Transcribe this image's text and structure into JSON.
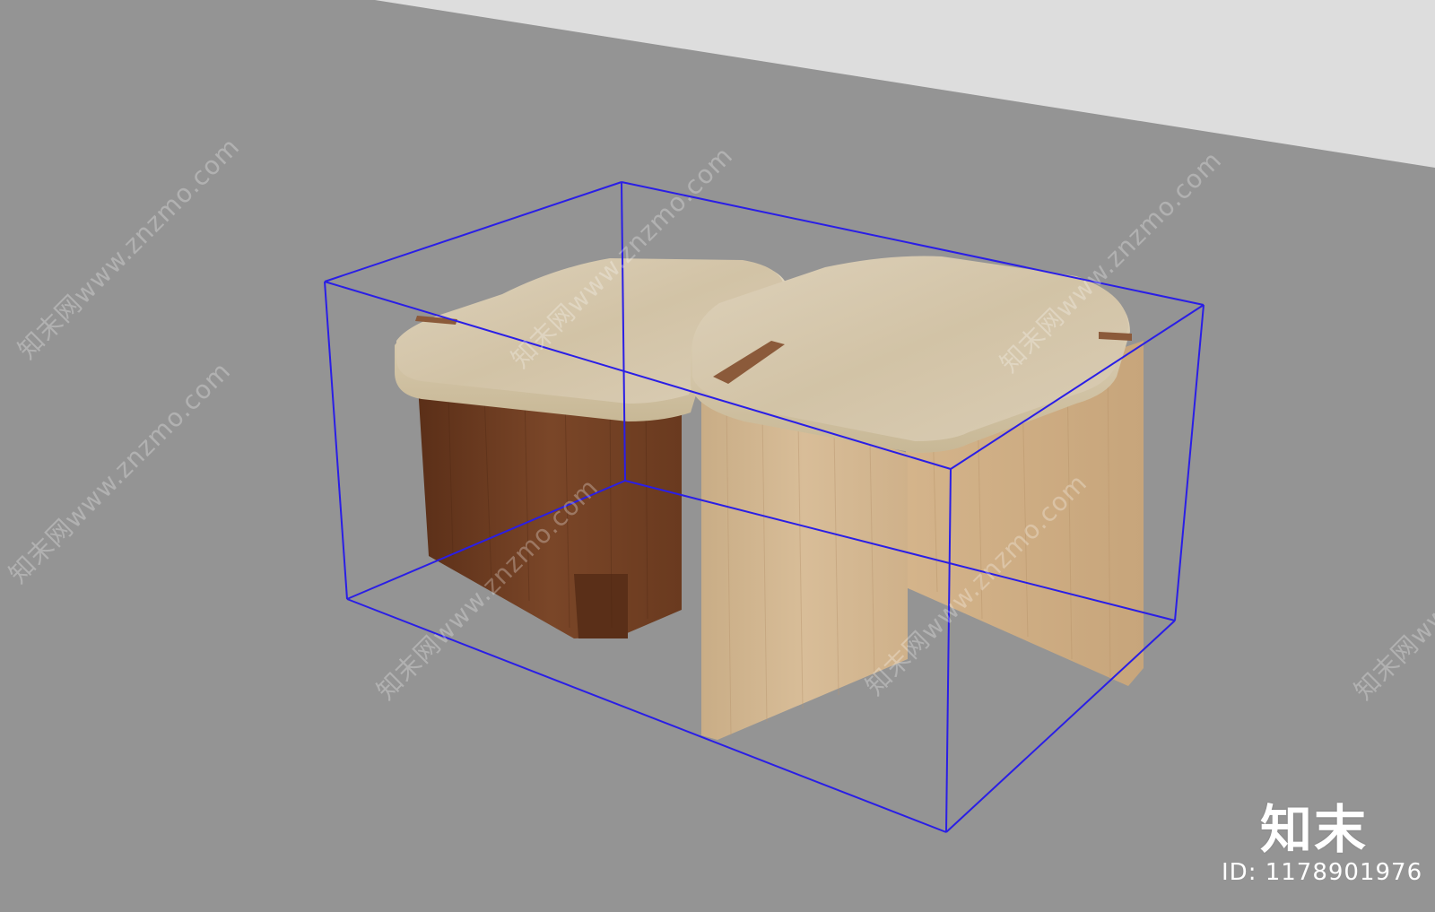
{
  "scene": {
    "colors": {
      "floor": "#949494",
      "background_wall": "#dddddd",
      "bounding_box": "#2a1ee6",
      "stone_top": "#d9ccb4",
      "stone_edge": "#cdbf9f",
      "walnut_wood": "#6e3e22",
      "oak_wood": "#d3b68e"
    },
    "objects": [
      "stone-top-left-table",
      "stone-top-right-table",
      "walnut-base",
      "oak-base",
      "selection-bounding-box"
    ]
  },
  "watermarks": {
    "text": "知末网www.znzmo.com"
  },
  "branding": {
    "logo_text": "知末",
    "id_text": "ID: 1178901976"
  }
}
